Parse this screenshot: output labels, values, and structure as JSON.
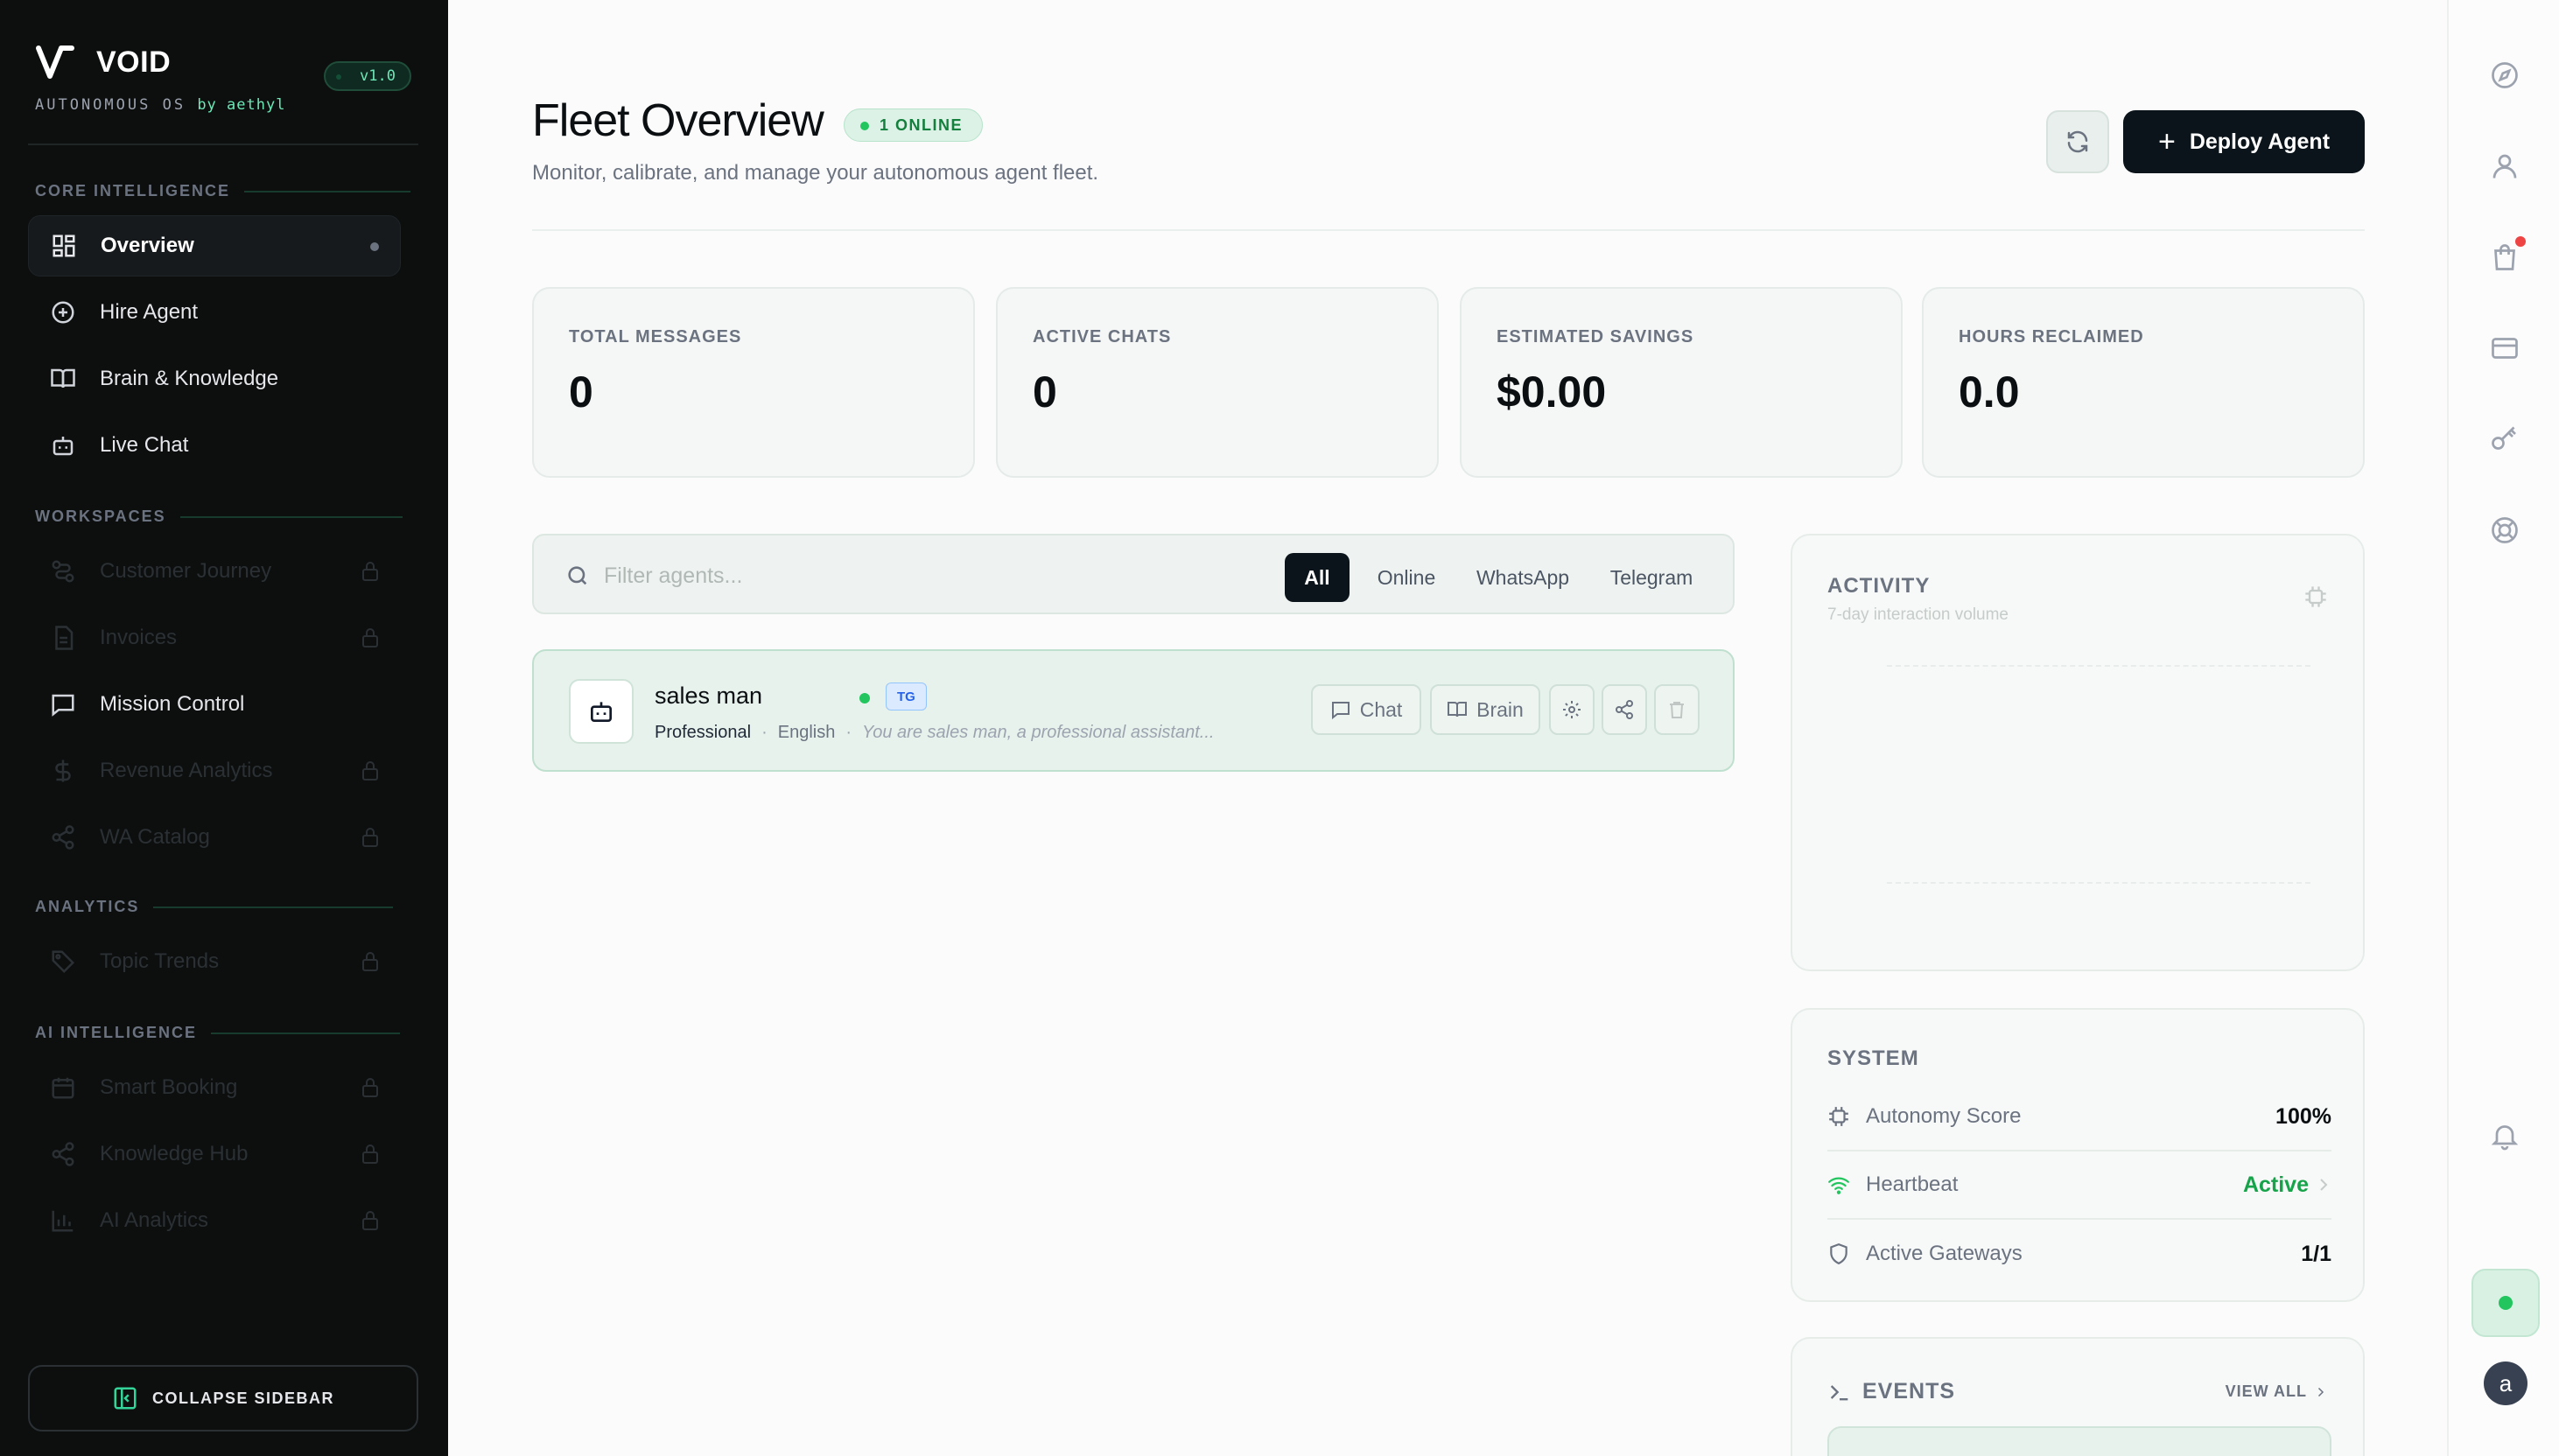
{
  "brand": {
    "name": "VOID",
    "tagline": "AUTONOMOUS OS",
    "by": "by aethyl",
    "version": "v1.0"
  },
  "sidebar": {
    "sections": [
      {
        "title": "CORE INTELLIGENCE"
      },
      {
        "title": "WORKSPACES"
      },
      {
        "title": "ANALYTICS"
      },
      {
        "title": "AI INTELLIGENCE"
      }
    ],
    "items": [
      {
        "label": "Overview",
        "icon": "grid-icon",
        "state": "active"
      },
      {
        "label": "Hire Agent",
        "icon": "plus-circle-icon",
        "state": "normal"
      },
      {
        "label": "Brain & Knowledge",
        "icon": "book-icon",
        "state": "normal"
      },
      {
        "label": "Live Chat",
        "icon": "robot-icon",
        "state": "normal"
      },
      {
        "label": "Customer Journey",
        "icon": "route-icon",
        "state": "locked"
      },
      {
        "label": "Invoices",
        "icon": "file-icon",
        "state": "locked"
      },
      {
        "label": "Mission Control",
        "icon": "message-square-icon",
        "state": "normal"
      },
      {
        "label": "Revenue Analytics",
        "icon": "dollar-icon",
        "state": "locked"
      },
      {
        "label": "WA Catalog",
        "icon": "share-icon",
        "state": "locked"
      },
      {
        "label": "Topic Trends",
        "icon": "tag-icon",
        "state": "locked"
      },
      {
        "label": "Smart Booking",
        "icon": "calendar-icon",
        "state": "locked"
      },
      {
        "label": "Knowledge Hub",
        "icon": "share-icon",
        "state": "locked"
      },
      {
        "label": "AI Analytics",
        "icon": "bar-chart-icon",
        "state": "locked"
      }
    ],
    "collapse_label": "COLLAPSE SIDEBAR"
  },
  "header": {
    "title": "Fleet Overview",
    "online_badge": "1 ONLINE",
    "subtitle": "Monitor, calibrate, and manage your autonomous agent fleet.",
    "deploy_label": "Deploy Agent"
  },
  "stats": [
    {
      "label": "TOTAL MESSAGES",
      "value": "0"
    },
    {
      "label": "ACTIVE CHATS",
      "value": "0"
    },
    {
      "label": "ESTIMATED SAVINGS",
      "value": "$0.00"
    },
    {
      "label": "HOURS RECLAIMED",
      "value": "0.0"
    }
  ],
  "filter": {
    "placeholder": "Filter agents...",
    "tabs": [
      "All",
      "Online",
      "WhatsApp",
      "Telegram"
    ],
    "active_tab": "All"
  },
  "agents": [
    {
      "name": "sales man",
      "status": "online",
      "tag": "TG",
      "tone": "Professional",
      "language": "English",
      "prompt": "You are sales man, a professional assistant...",
      "actions": {
        "chat": "Chat",
        "brain": "Brain"
      }
    }
  ],
  "activity": {
    "title": "ACTIVITY",
    "subtitle": "7-day interaction volume"
  },
  "system": {
    "title": "SYSTEM",
    "rows": [
      {
        "label": "Autonomy Score",
        "value": "100%"
      },
      {
        "label": "Heartbeat",
        "value": "Active"
      },
      {
        "label": "Active Gateways",
        "value": "1/1"
      }
    ]
  },
  "events": {
    "title": "EVENTS",
    "view_all": "VIEW ALL"
  },
  "user": {
    "initial": "a"
  },
  "colors": {
    "accent": "#22c55e",
    "dark": "#0b141a",
    "sidebar_bg": "#0d0f0f",
    "alert": "#ef4444"
  }
}
